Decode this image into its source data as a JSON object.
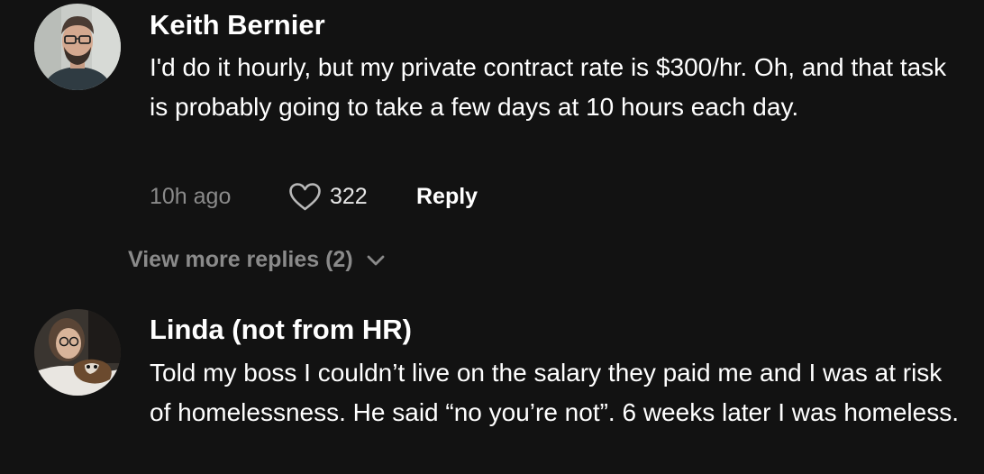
{
  "comments": [
    {
      "username": "Keith Bernier",
      "text": "I'd do it hourly, but my private contract rate is $300/hr. Oh, and that task is probably going to take a few days at 10 hours each day.",
      "timestamp": "10h ago",
      "likes": "322",
      "reply_label": "Reply",
      "avatar_icon": "avatar-photo"
    },
    {
      "username": "Linda (not from HR)",
      "text": "Told my boss I couldn’t live on the salary they paid me and I was at risk of homelessness. He said “no you’re not”. 6 weeks later I was homeless.",
      "avatar_icon": "avatar-photo"
    }
  ],
  "view_more": {
    "label": "View more replies (2)",
    "icon": "chevron-down-icon"
  },
  "colors": {
    "background": "#121212",
    "primary_text": "#ffffff",
    "secondary_text": "#8a8a8a"
  }
}
